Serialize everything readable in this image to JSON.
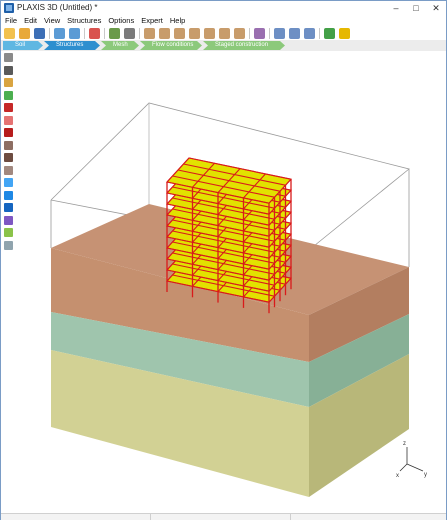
{
  "titlebar": {
    "title": "PLAXIS 3D (Untitled) *",
    "minimize": "–",
    "maximize": "□",
    "close": "✕"
  },
  "menubar": {
    "items": [
      "File",
      "Edit",
      "View",
      "Structures",
      "Options",
      "Expert",
      "Help"
    ]
  },
  "toolbar": {
    "buttons": [
      "new-project-icon",
      "open-project-icon",
      "save-project-icon",
      "undo-icon",
      "redo-icon",
      "delete-icon",
      "select-all-icon",
      "print-icon",
      "view-3d-icon",
      "view-front-icon",
      "view-back-icon",
      "view-side-icon",
      "view-top-icon",
      "view-bottom-icon",
      "view-perspective-icon",
      "hide-icon",
      "zoom-in-icon",
      "zoom-out-icon",
      "zoom-window-icon",
      "pan-icon",
      "rotate-icon"
    ]
  },
  "phases": [
    {
      "label": "Soil",
      "active": false
    },
    {
      "label": "Structures",
      "active": true
    },
    {
      "label": "Mesh",
      "active": false
    },
    {
      "label": "Flow conditions",
      "active": false
    },
    {
      "label": "Staged construction",
      "active": false
    }
  ],
  "sidebar": {
    "tools": [
      "select-cursor-icon",
      "create-line-icon",
      "create-point-icon",
      "create-surface-icon",
      "create-polygon-icon",
      "create-point-load-icon",
      "create-beam-icon",
      "create-anchor-icon",
      "create-tunnel-icon",
      "create-well-icon",
      "create-drain-icon",
      "create-embedded-beam-icon",
      "create-interface-icon",
      "create-volume-icon",
      "import-geometry-icon",
      "array-icon"
    ]
  },
  "viewport": {
    "axes": {
      "x": "x",
      "y": "y",
      "z": "z"
    }
  },
  "colors": {
    "soil_top": "#c69274",
    "soil_middle": "#9fc5ad",
    "soil_bottom": "#d2d194",
    "beam": "#d81b1b",
    "floor": "#e2e200",
    "phase_active": "#2e8fcf",
    "phase_soil": "#5fb7e2",
    "phase_inactive": "#8cc97b"
  }
}
